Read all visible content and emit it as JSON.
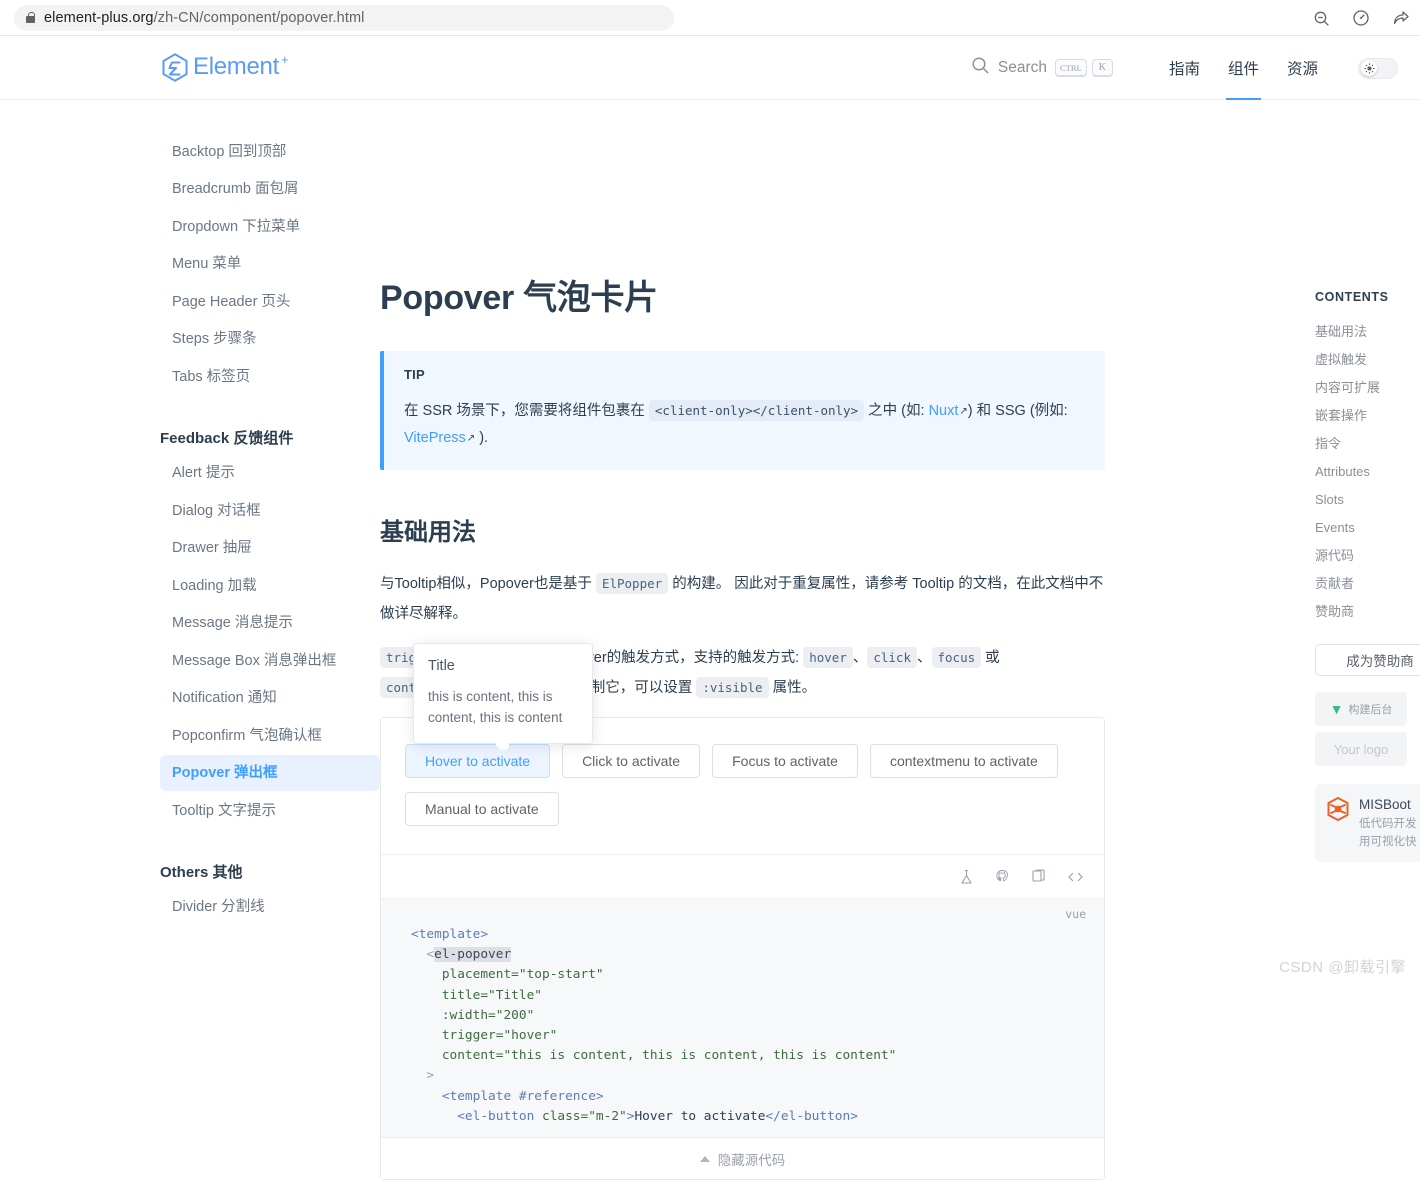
{
  "browser": {
    "url_secure": "element-plus.org",
    "url_path": "/zh-CN/component/popover.html",
    "actions": [
      "zoom-out-icon",
      "performance-icon",
      "share-icon"
    ]
  },
  "header": {
    "logo_text": "Element",
    "logo_plus": "+",
    "search": {
      "label": "Search",
      "key_ctrl": "CTRL",
      "key_letter": "K"
    },
    "nav": [
      {
        "label": "指南",
        "active": false
      },
      {
        "label": "组件",
        "active": true
      },
      {
        "label": "资源",
        "active": false
      }
    ],
    "theme_toggle": "sun-icon"
  },
  "sidebar": {
    "items": [
      {
        "label": "Backtop 回到顶部",
        "type": "item",
        "active": false
      },
      {
        "label": "Breadcrumb 面包屑",
        "type": "item",
        "active": false
      },
      {
        "label": "Dropdown 下拉菜单",
        "type": "item",
        "active": false
      },
      {
        "label": "Menu 菜单",
        "type": "item",
        "active": false
      },
      {
        "label": "Page Header 页头",
        "type": "item",
        "active": false
      },
      {
        "label": "Steps 步骤条",
        "type": "item",
        "active": false
      },
      {
        "label": "Tabs 标签页",
        "type": "item",
        "active": false
      },
      {
        "label": "Feedback 反馈组件",
        "type": "group"
      },
      {
        "label": "Alert 提示",
        "type": "item",
        "active": false
      },
      {
        "label": "Dialog 对话框",
        "type": "item",
        "active": false
      },
      {
        "label": "Drawer 抽屉",
        "type": "item",
        "active": false
      },
      {
        "label": "Loading 加载",
        "type": "item",
        "active": false
      },
      {
        "label": "Message 消息提示",
        "type": "item",
        "active": false
      },
      {
        "label": "Message Box 消息弹出框",
        "type": "item",
        "active": false
      },
      {
        "label": "Notification 通知",
        "type": "item",
        "active": false
      },
      {
        "label": "Popconfirm 气泡确认框",
        "type": "item",
        "active": false
      },
      {
        "label": "Popover 弹出框",
        "type": "item",
        "active": true
      },
      {
        "label": "Tooltip 文字提示",
        "type": "item",
        "active": false
      },
      {
        "label": "Others 其他",
        "type": "group"
      },
      {
        "label": "Divider 分割线",
        "type": "item",
        "active": false
      }
    ]
  },
  "main": {
    "title": "Popover 气泡卡片",
    "tip": {
      "label": "TIP",
      "text_1": "在 SSR 场景下，您需要将组件包裹在",
      "code": "<client-only></client-only>",
      "text_2": "之中 (如:",
      "link_1": "Nuxt",
      "text_3": ") 和 SSG (例如:",
      "link_2": "VitePress",
      "text_4": ")."
    },
    "section_title": "基础用法",
    "para_1_a": "与Tooltip相似，Popover也是基于",
    "para_1_code": "ElPopper",
    "para_1_b": "的构建。 因此对于重复属性，请参考 Tooltip 的文档，在此文档中不做详尽解释。",
    "para_2_code_1": "trigger",
    "para_2_a": "属性被用来决定 popover",
    "para_2_b": "的触发方式，支持的触发方式:",
    "para_2_codes": [
      "hover",
      "click",
      "focus"
    ],
    "para_2_or": "或",
    "para_2_code_last": "contextmenu",
    "para_2_c": "。如果你想手动控制它，可以设置",
    "para_2_code_visible": ":visible",
    "para_2_d": "属性。",
    "popover": {
      "title": "Title",
      "content": "this is content, this is content, this is content"
    },
    "demo_buttons": [
      {
        "label": "Hover to activate",
        "state": "active"
      },
      {
        "label": "Click to activate",
        "state": "default"
      },
      {
        "label": "Focus to activate",
        "state": "default"
      },
      {
        "label": "contextmenu to activate",
        "state": "default"
      },
      {
        "label": "Manual to activate",
        "state": "default"
      }
    ],
    "demo_actions": [
      "playground-icon",
      "github-icon",
      "copy-icon",
      "code-icon"
    ],
    "code_lang": "vue",
    "code_lines": [
      [
        {
          "t": "tag",
          "v": "<template>"
        }
      ],
      [
        {
          "t": "punct",
          "v": "  <"
        },
        {
          "t": "sel",
          "v": "el-popover"
        }
      ],
      [
        {
          "t": "attr",
          "v": "    placement="
        },
        {
          "t": "str",
          "v": "\"top-start\""
        }
      ],
      [
        {
          "t": "attr",
          "v": "    title="
        },
        {
          "t": "str",
          "v": "\"Title\""
        }
      ],
      [
        {
          "t": "attr",
          "v": "    :width="
        },
        {
          "t": "str",
          "v": "\"200\""
        }
      ],
      [
        {
          "t": "attr",
          "v": "    trigger="
        },
        {
          "t": "str",
          "v": "\"hover\""
        }
      ],
      [
        {
          "t": "attr",
          "v": "    content="
        },
        {
          "t": "str",
          "v": "\"this is content, this is content, this is content\""
        }
      ],
      [
        {
          "t": "punct",
          "v": "  >"
        }
      ],
      [
        {
          "t": "tag",
          "v": "    <template #reference>"
        }
      ],
      [
        {
          "t": "tag",
          "v": "      <el-button "
        },
        {
          "t": "attr",
          "v": "class="
        },
        {
          "t": "str",
          "v": "\"m-2\""
        },
        {
          "t": "tag",
          "v": ">"
        },
        {
          "t": "text",
          "v": "Hover to activate"
        },
        {
          "t": "tag",
          "v": "</el-button>"
        }
      ]
    ],
    "code_footer": "隐藏源代码"
  },
  "rail": {
    "title": "CONTENTS",
    "links": [
      "基础用法",
      "虚拟触发",
      "内容可扩展",
      "嵌套操作",
      "指令",
      "Attributes",
      "Slots",
      "Events",
      "源代码",
      "贡献者",
      "赞助商"
    ],
    "sponsor_button": "成为赞助商",
    "sponsor_tiles": [
      "构建后台",
      "Your logo"
    ],
    "ad": {
      "title": "MISBoot",
      "desc_1": "低代码开发",
      "desc_2": "用可视化快"
    }
  },
  "watermark": "CSDN @卸载引擎",
  "colors": {
    "accent": "#409eff",
    "accent_bg": "#ecf5ff",
    "tip_bg": "#f0f7ff",
    "code_bg": "#f7f8fa",
    "text": "#2c3e50",
    "muted": "#8a8f99"
  }
}
